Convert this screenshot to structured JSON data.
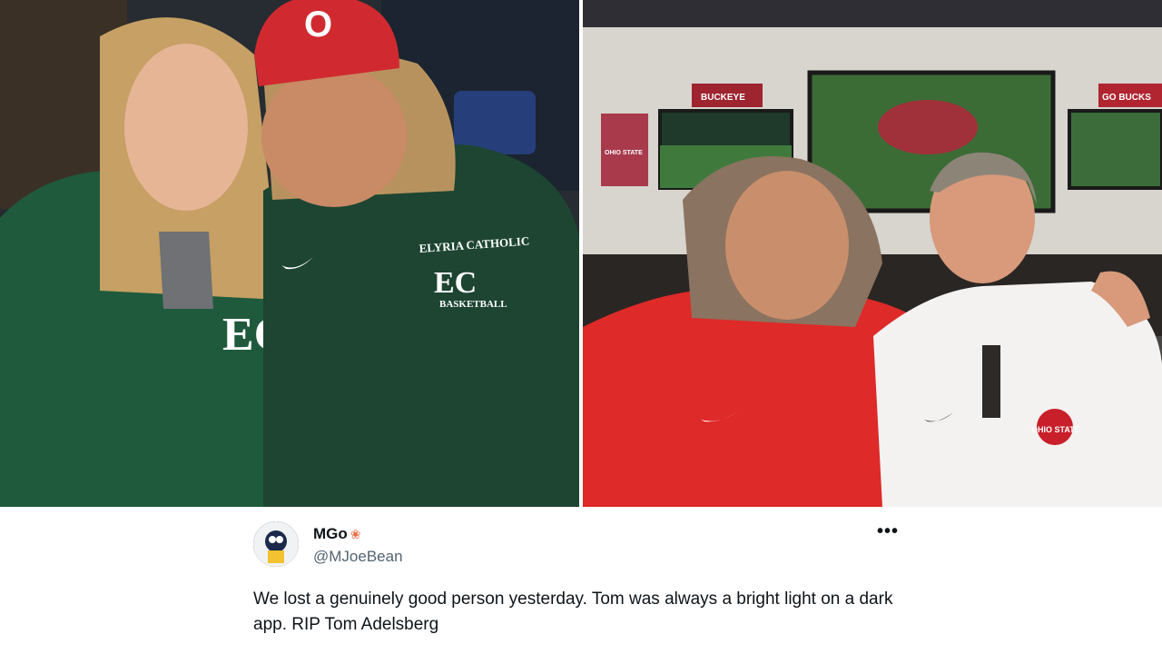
{
  "tweet": {
    "display_name": "MGo",
    "handle": "@MJoeBean",
    "text": "We lost a genuinely good person yesterday. Tom was always a bright light on a dark app. RIP Tom Adelsberg",
    "badge_icon": "paw-icon",
    "menu_icon": "more-options-icon"
  },
  "left_photo": {
    "cap_logo": "O",
    "jacket_text_line1": "ELYRIA CATHOLIC",
    "jacket_text_line2": "BASKETBALL",
    "jacket_logo": "EC"
  },
  "right_photo": {
    "banner_1": "BUCKEYE",
    "banner_2": "OHIO STATE",
    "banner_3": "GO BUCKS",
    "shirt_logo": "OHIO STATE"
  },
  "colors": {
    "ohio_scarlet": "#d3202a",
    "jacket_green": "#1f4d36",
    "tweet_text": "#0f1419",
    "tweet_handle": "#536471"
  }
}
